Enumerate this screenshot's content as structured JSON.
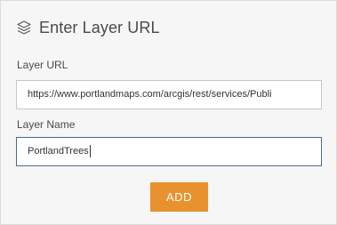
{
  "header": {
    "title": "Enter Layer URL",
    "icon": "layers-icon"
  },
  "layer_url": {
    "label": "Layer URL",
    "value": "https://www.portlandmaps.com/arcgis/rest/services/Publi"
  },
  "layer_name": {
    "label": "Layer Name",
    "value": "PortlandTrees"
  },
  "add_button": {
    "label": "ADD",
    "color": "#e8922f"
  }
}
